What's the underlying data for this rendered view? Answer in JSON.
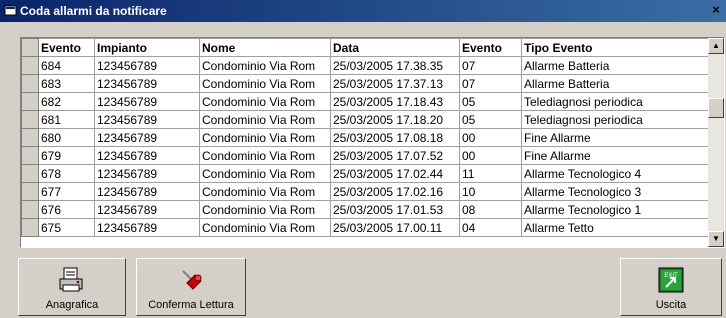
{
  "window": {
    "title": "Coda allarmi da notificare",
    "close_glyph": "×"
  },
  "grid": {
    "columns": [
      "Evento",
      "Impianto",
      "Nome",
      "Data",
      "Evento",
      "Tipo Evento"
    ],
    "rows": [
      [
        "684",
        "123456789",
        "Condominio Via Rom",
        "25/03/2005 17.38.35",
        "07",
        "Allarme Batteria"
      ],
      [
        "683",
        "123456789",
        "Condominio Via Rom",
        "25/03/2005 17.37.13",
        "07",
        "Allarme Batteria"
      ],
      [
        "682",
        "123456789",
        "Condominio Via Rom",
        "25/03/2005 17.18.43",
        "05",
        "Telediagnosi periodica"
      ],
      [
        "681",
        "123456789",
        "Condominio Via Rom",
        "25/03/2005 17.18.20",
        "05",
        "Telediagnosi periodica"
      ],
      [
        "680",
        "123456789",
        "Condominio Via Rom",
        "25/03/2005 17.08.18",
        "00",
        "Fine Allarme"
      ],
      [
        "679",
        "123456789",
        "Condominio Via Rom",
        "25/03/2005 17.07.52",
        "00",
        "Fine Allarme"
      ],
      [
        "678",
        "123456789",
        "Condominio Via Rom",
        "25/03/2005 17.02.44",
        "11",
        "Allarme Tecnologico 4"
      ],
      [
        "677",
        "123456789",
        "Condominio Via Rom",
        "25/03/2005 17.02.16",
        "10",
        "Allarme Tecnologico 3"
      ],
      [
        "676",
        "123456789",
        "Condominio Via Rom",
        "25/03/2005 17.01.53",
        "08",
        "Allarme Tecnologico 1"
      ],
      [
        "675",
        "123456789",
        "Condominio Via Rom",
        "25/03/2005 17.00.11",
        "04",
        "Allarme Tetto"
      ]
    ]
  },
  "buttons": {
    "anagrafica": {
      "label": "Anagrafica",
      "icon": "document-printer-icon"
    },
    "conferma": {
      "label": "Conferma Lettura",
      "icon": "pushpin-icon"
    },
    "uscita": {
      "label": "Uscita",
      "icon": "exit-icon",
      "icon_text": "EXIT"
    }
  }
}
